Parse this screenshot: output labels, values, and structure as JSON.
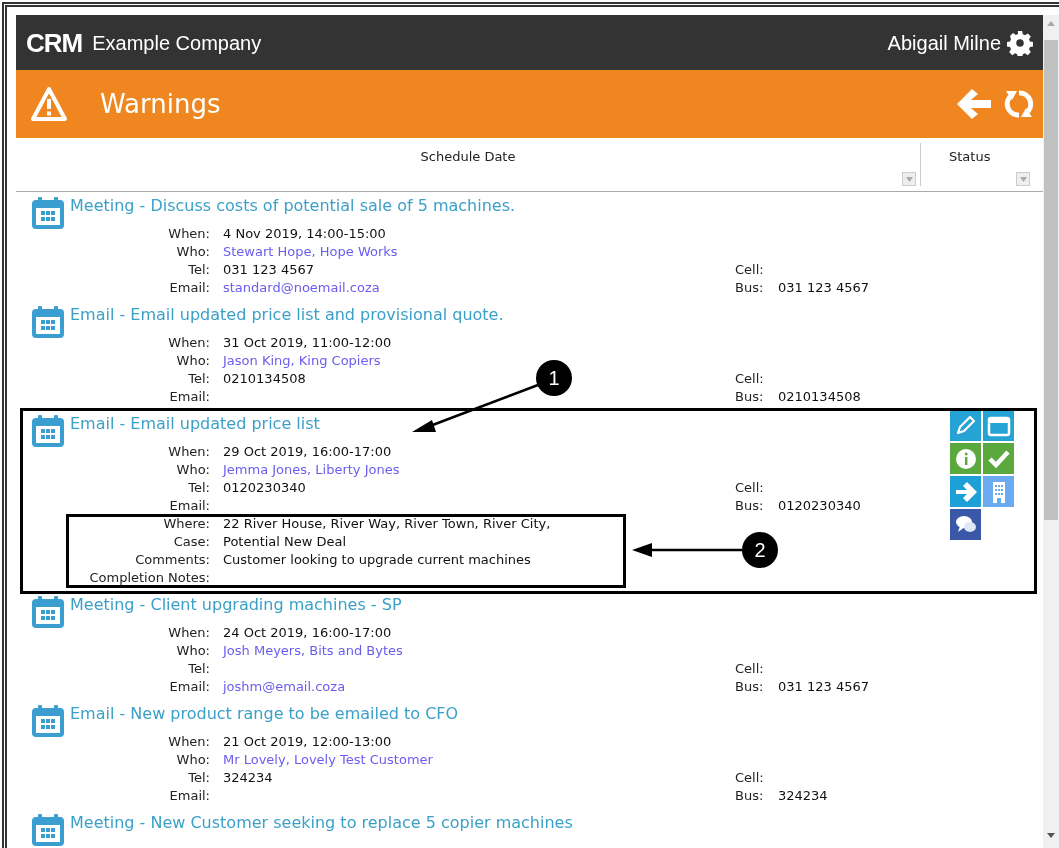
{
  "header": {
    "logo": "CRM",
    "company": "Example Company",
    "user": "Abigail Milne"
  },
  "page_title": "Warnings",
  "columns": [
    "Schedule Date",
    "Status"
  ],
  "entries": [
    {
      "title": "Meeting - Discuss costs of potential sale of 5 machines.",
      "fields": [
        {
          "label": "When:",
          "value": "4 Nov 2019, 14:00-15:00",
          "kind": "text"
        },
        {
          "label": "Who:",
          "value": "Stewart Hope, Hope Works",
          "kind": "link"
        },
        {
          "label": "Tel:",
          "value": "031 123 4567",
          "kind": "text"
        },
        {
          "label": "Email:",
          "value": "standard@noemail.coza",
          "kind": "link"
        }
      ],
      "contact": [
        {
          "label": "Cell:"
        },
        {
          "label": "Bus:",
          "value": "031 123 4567"
        }
      ]
    },
    {
      "title": "Email - Email updated price list and provisional quote.",
      "fields": [
        {
          "label": "When:",
          "value": "31 Oct 2019, 11:00-12:00",
          "kind": "text"
        },
        {
          "label": "Who:",
          "value": "Jason King, King Copiers",
          "kind": "link"
        },
        {
          "label": "Tel:",
          "value": "0210134508",
          "kind": "text"
        },
        {
          "label": "Email:"
        }
      ],
      "contact": [
        {
          "label": "Cell:"
        },
        {
          "label": "Bus:",
          "value": "0210134508"
        }
      ]
    },
    {
      "title": "Email - Email updated price list",
      "fields": [
        {
          "label": "When:",
          "value": "29 Oct 2019, 16:00-17:00",
          "kind": "text"
        },
        {
          "label": "Who:",
          "value": "Jemma Jones, Liberty Jones",
          "kind": "link"
        },
        {
          "label": "Tel:",
          "value": "0120230340",
          "kind": "text"
        },
        {
          "label": "Email:"
        },
        {
          "label": "Where:",
          "value": "22 River House, River Way, River Town, River City,",
          "kind": "text"
        },
        {
          "label": "Case:",
          "value": "Potential New Deal",
          "kind": "text"
        },
        {
          "label": "Comments:",
          "value": "Customer looking to upgrade current machines",
          "kind": "text"
        },
        {
          "label": "Completion Notes:"
        }
      ],
      "contact": [
        {
          "label": "Cell:"
        },
        {
          "label": "Bus:",
          "value": "0120230340"
        }
      ],
      "actions": [
        {
          "kind": "edit"
        },
        {
          "kind": "calendar"
        },
        {
          "kind": "info"
        },
        {
          "kind": "complete"
        },
        {
          "kind": "forward"
        },
        {
          "kind": "company"
        },
        {
          "kind": "chat"
        }
      ]
    },
    {
      "title": "Meeting - Client upgrading machines - SP",
      "fields": [
        {
          "label": "When:",
          "value": "24 Oct 2019, 16:00-17:00",
          "kind": "text"
        },
        {
          "label": "Who:",
          "value": "Josh Meyers, Bits and Bytes",
          "kind": "link"
        },
        {
          "label": "Tel:"
        },
        {
          "label": "Email:",
          "value": "joshm@email.coza",
          "kind": "link"
        }
      ],
      "contact": [
        {
          "label": "Cell:"
        },
        {
          "label": "Bus:",
          "value": "031 123 4567"
        }
      ]
    },
    {
      "title": "Email - New product range to be emailed to CFO",
      "fields": [
        {
          "label": "When:",
          "value": "21 Oct 2019, 12:00-13:00",
          "kind": "text"
        },
        {
          "label": "Who:",
          "value": "Mr Lovely, Lovely Test Customer",
          "kind": "link"
        },
        {
          "label": "Tel:",
          "value": "324234",
          "kind": "text"
        },
        {
          "label": "Email:"
        }
      ],
      "contact": [
        {
          "label": "Cell:"
        },
        {
          "label": "Bus:",
          "value": "324234"
        }
      ]
    },
    {
      "title": "Meeting - New Customer seeking to replace 5 copier machines"
    }
  ],
  "callouts": [
    {
      "number": "1"
    },
    {
      "number": "2"
    }
  ]
}
